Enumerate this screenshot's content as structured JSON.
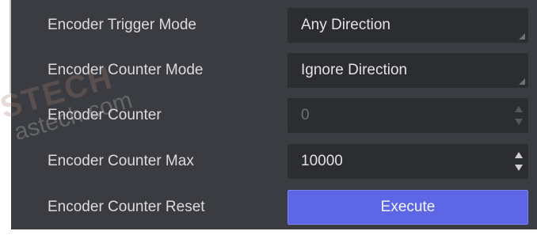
{
  "rows": [
    {
      "label": "Encoder Trigger Mode",
      "value": "Any Direction",
      "control": "dropdown"
    },
    {
      "label": "Encoder Counter Mode",
      "value": "Ignore Direction",
      "control": "dropdown"
    },
    {
      "label": "Encoder Counter",
      "value": "0",
      "control": "spinbox",
      "disabled": true
    },
    {
      "label": "Encoder Counter Max",
      "value": "10000",
      "control": "spinbox"
    },
    {
      "label": "Encoder Counter Reset",
      "value": "Execute",
      "control": "button"
    }
  ],
  "watermark": {
    "logo": "STECH",
    "url": "astech.com"
  },
  "colors": {
    "panel_bg": "#3a3c42",
    "field_bg": "#2b2d31",
    "label_text": "#dcdcdc",
    "button_bg": "#5d67e6"
  }
}
